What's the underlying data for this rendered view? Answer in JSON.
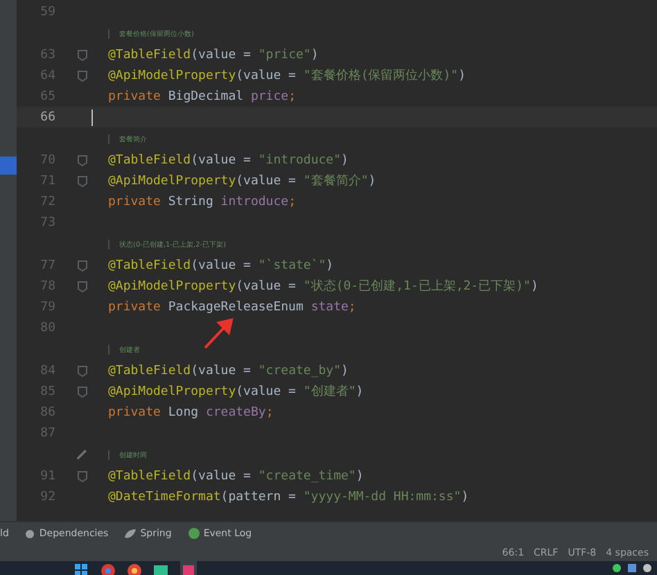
{
  "editor": {
    "rows": [
      {
        "kind": "code",
        "number": "59",
        "fold": false,
        "current": false,
        "tokens": []
      },
      {
        "kind": "doc",
        "text": "套餐价格(保留两位小数)",
        "edit": false
      },
      {
        "kind": "code",
        "number": "63",
        "fold": true,
        "current": false,
        "tokens": [
          {
            "t": "@TableField",
            "kind": "annotation"
          },
          {
            "t": "(value = ",
            "kind": "plain"
          },
          {
            "t": "\"price\"",
            "kind": "string"
          },
          {
            "t": ")",
            "kind": "plain"
          }
        ]
      },
      {
        "kind": "code",
        "number": "64",
        "fold": true,
        "current": false,
        "tokens": [
          {
            "t": "@ApiModelProperty",
            "kind": "annotation"
          },
          {
            "t": "(value = ",
            "kind": "plain"
          },
          {
            "t": "\"套餐价格(保留两位小数)\"",
            "kind": "string"
          },
          {
            "t": ")",
            "kind": "plain"
          }
        ]
      },
      {
        "kind": "code",
        "number": "65",
        "fold": false,
        "current": false,
        "tokens": [
          {
            "t": "private ",
            "kind": "keyword"
          },
          {
            "t": "BigDecimal ",
            "kind": "plain"
          },
          {
            "t": "price",
            "kind": "field"
          },
          {
            "t": ";",
            "kind": "keyword"
          }
        ]
      },
      {
        "kind": "code",
        "number": "66",
        "fold": false,
        "current": true,
        "tokens": []
      },
      {
        "kind": "doc",
        "text": "套餐简介",
        "edit": false
      },
      {
        "kind": "code",
        "number": "70",
        "fold": true,
        "current": false,
        "tokens": [
          {
            "t": "@TableField",
            "kind": "annotation"
          },
          {
            "t": "(value = ",
            "kind": "plain"
          },
          {
            "t": "\"introduce\"",
            "kind": "string"
          },
          {
            "t": ")",
            "kind": "plain"
          }
        ]
      },
      {
        "kind": "code",
        "number": "71",
        "fold": true,
        "current": false,
        "tokens": [
          {
            "t": "@ApiModelProperty",
            "kind": "annotation"
          },
          {
            "t": "(value = ",
            "kind": "plain"
          },
          {
            "t": "\"套餐简介\"",
            "kind": "string"
          },
          {
            "t": ")",
            "kind": "plain"
          }
        ]
      },
      {
        "kind": "code",
        "number": "72",
        "fold": false,
        "current": false,
        "tokens": [
          {
            "t": "private ",
            "kind": "keyword"
          },
          {
            "t": "String ",
            "kind": "plain"
          },
          {
            "t": "introduce",
            "kind": "field"
          },
          {
            "t": ";",
            "kind": "keyword"
          }
        ]
      },
      {
        "kind": "code",
        "number": "73",
        "fold": false,
        "current": false,
        "tokens": []
      },
      {
        "kind": "doc",
        "text": "状态(0-已创建,1-已上架,2-已下架)",
        "edit": false
      },
      {
        "kind": "code",
        "number": "77",
        "fold": true,
        "current": false,
        "tokens": [
          {
            "t": "@TableField",
            "kind": "annotation"
          },
          {
            "t": "(value = ",
            "kind": "plain"
          },
          {
            "t": "\"`state`\"",
            "kind": "string"
          },
          {
            "t": ")",
            "kind": "plain"
          }
        ]
      },
      {
        "kind": "code",
        "number": "78",
        "fold": true,
        "current": false,
        "tokens": [
          {
            "t": "@ApiModelProperty",
            "kind": "annotation"
          },
          {
            "t": "(value = ",
            "kind": "plain"
          },
          {
            "t": "\"状态(0-已创建,1-已上架,2-已下架)\"",
            "kind": "string"
          },
          {
            "t": ")",
            "kind": "plain"
          }
        ]
      },
      {
        "kind": "code",
        "number": "79",
        "fold": false,
        "current": false,
        "tokens": [
          {
            "t": "private ",
            "kind": "keyword"
          },
          {
            "t": "PackageReleaseEnum ",
            "kind": "plain"
          },
          {
            "t": "state",
            "kind": "field"
          },
          {
            "t": ";",
            "kind": "keyword"
          }
        ]
      },
      {
        "kind": "code",
        "number": "80",
        "fold": false,
        "current": false,
        "tokens": []
      },
      {
        "kind": "doc",
        "text": "创建者",
        "edit": false
      },
      {
        "kind": "code",
        "number": "84",
        "fold": true,
        "current": false,
        "tokens": [
          {
            "t": "@TableField",
            "kind": "annotation"
          },
          {
            "t": "(value = ",
            "kind": "plain"
          },
          {
            "t": "\"create_by\"",
            "kind": "string"
          },
          {
            "t": ")",
            "kind": "plain"
          }
        ]
      },
      {
        "kind": "code",
        "number": "85",
        "fold": true,
        "current": false,
        "tokens": [
          {
            "t": "@ApiModelProperty",
            "kind": "annotation"
          },
          {
            "t": "(value = ",
            "kind": "plain"
          },
          {
            "t": "\"创建者\"",
            "kind": "string"
          },
          {
            "t": ")",
            "kind": "plain"
          }
        ]
      },
      {
        "kind": "code",
        "number": "86",
        "fold": false,
        "current": false,
        "tokens": [
          {
            "t": "private ",
            "kind": "keyword"
          },
          {
            "t": "Long ",
            "kind": "plain"
          },
          {
            "t": "createBy",
            "kind": "field"
          },
          {
            "t": ";",
            "kind": "keyword"
          }
        ]
      },
      {
        "kind": "code",
        "number": "87",
        "fold": false,
        "current": false,
        "tokens": []
      },
      {
        "kind": "doc",
        "text": "创建时间",
        "edit": true
      },
      {
        "kind": "code",
        "number": "91",
        "fold": true,
        "current": false,
        "tokens": [
          {
            "t": "@TableField",
            "kind": "annotation"
          },
          {
            "t": "(value = ",
            "kind": "plain"
          },
          {
            "t": "\"create_time\"",
            "kind": "string"
          },
          {
            "t": ")",
            "kind": "plain"
          }
        ]
      },
      {
        "kind": "code",
        "number": "92",
        "fold": false,
        "current": false,
        "tokens": [
          {
            "t": "@DateTimeFormat",
            "kind": "annotation"
          },
          {
            "t": "(pattern = ",
            "kind": "plain"
          },
          {
            "t": "\"yyyy-MM-dd HH:mm:ss\"",
            "kind": "string"
          },
          {
            "t": ")",
            "kind": "plain"
          }
        ]
      }
    ]
  },
  "tool_tabs": [
    {
      "label": "ld"
    },
    {
      "label": "Dependencies"
    },
    {
      "label": "Spring"
    },
    {
      "label": "Event Log"
    }
  ],
  "status_bar": [
    "66:1",
    "CRLF",
    "UTF-8",
    "4 spaces"
  ]
}
